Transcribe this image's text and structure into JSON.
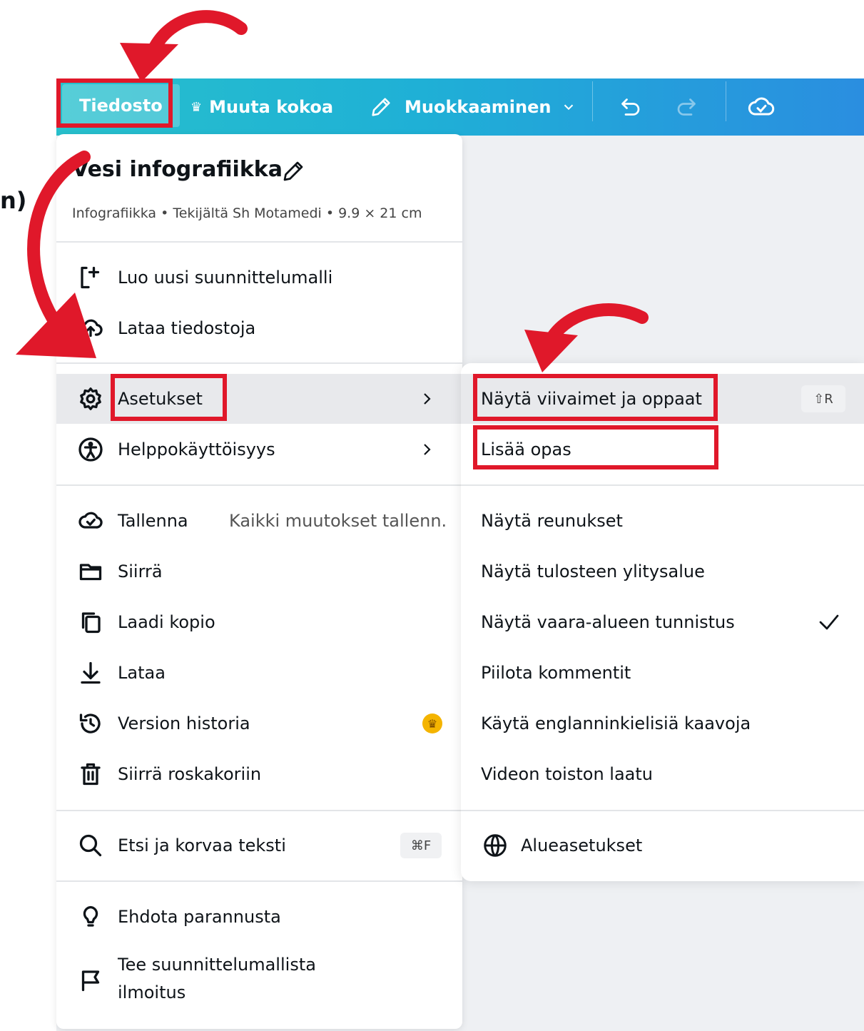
{
  "toolbar": {
    "file": "Tiedosto",
    "resize": "Muuta kokoa",
    "editing": "Muokkaaminen"
  },
  "side_text": "n)",
  "file_menu": {
    "title": "Vesi infografiikka",
    "subtitle": "Infografiikka • Tekijältä Sh Motamedi • 9.9 × 21 cm",
    "items": [
      {
        "label": "Luo uusi suunnittelumalli"
      },
      {
        "label": "Lataa tiedostoja"
      },
      {
        "label": "Asetukset"
      },
      {
        "label": "Helppokäyttöisyys"
      },
      {
        "label": "Tallenna",
        "hint": "Kaikki muutokset tallenn."
      },
      {
        "label": "Siirrä"
      },
      {
        "label": "Laadi kopio"
      },
      {
        "label": "Lataa"
      },
      {
        "label": "Version historia"
      },
      {
        "label": "Siirrä roskakoriin"
      },
      {
        "label": "Etsi ja korvaa teksti",
        "shortcut": "⌘F"
      },
      {
        "label": "Ehdota parannusta"
      },
      {
        "label": "Tee suunnittelumallista",
        "label2": "ilmoitus"
      }
    ]
  },
  "settings_menu": {
    "items": [
      {
        "label": "Näytä viivaimet ja oppaat",
        "shortcut": "⇧R"
      },
      {
        "label": "Lisää opas"
      },
      {
        "label": "Näytä reunukset"
      },
      {
        "label": "Näytä tulosteen ylitysalue"
      },
      {
        "label": "Näytä vaara-alueen tunnistus",
        "checked": true
      },
      {
        "label": "Piilota kommentit"
      },
      {
        "label": "Käytä englanninkielisiä kaavoja"
      },
      {
        "label": "Videon toiston laatu"
      },
      {
        "label": "Alueasetukset"
      }
    ]
  },
  "colors": {
    "highlight": "#e0182a",
    "toolbar_start": "#27c0cc",
    "toolbar_end": "#2a8ee0",
    "premium": "#f4b400"
  }
}
